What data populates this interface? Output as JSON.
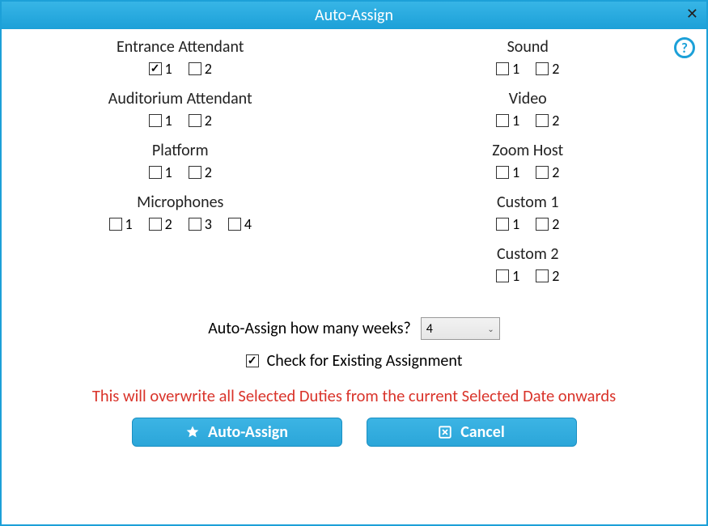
{
  "title": "Auto-Assign",
  "help_icon": "?",
  "groups_left": [
    {
      "label": "Entrance Attendant",
      "boxes": [
        {
          "label": "1",
          "checked": true
        },
        {
          "label": "2",
          "checked": false
        }
      ]
    },
    {
      "label": "Auditorium Attendant",
      "boxes": [
        {
          "label": "1",
          "checked": false
        },
        {
          "label": "2",
          "checked": false
        }
      ]
    },
    {
      "label": "Platform",
      "boxes": [
        {
          "label": "1",
          "checked": false
        },
        {
          "label": "2",
          "checked": false
        }
      ]
    },
    {
      "label": "Microphones",
      "boxes": [
        {
          "label": "1",
          "checked": false
        },
        {
          "label": "2",
          "checked": false
        },
        {
          "label": "3",
          "checked": false
        },
        {
          "label": "4",
          "checked": false
        }
      ]
    }
  ],
  "groups_right": [
    {
      "label": "Sound",
      "boxes": [
        {
          "label": "1",
          "checked": false
        },
        {
          "label": "2",
          "checked": false
        }
      ]
    },
    {
      "label": "Video",
      "boxes": [
        {
          "label": "1",
          "checked": false
        },
        {
          "label": "2",
          "checked": false
        }
      ]
    },
    {
      "label": "Zoom Host",
      "boxes": [
        {
          "label": "1",
          "checked": false
        },
        {
          "label": "2",
          "checked": false
        }
      ]
    },
    {
      "label": "Custom 1",
      "boxes": [
        {
          "label": "1",
          "checked": false
        },
        {
          "label": "2",
          "checked": false
        }
      ]
    },
    {
      "label": "Custom 2",
      "boxes": [
        {
          "label": "1",
          "checked": false
        },
        {
          "label": "2",
          "checked": false
        }
      ]
    }
  ],
  "weeks_label": "Auto-Assign how many weeks?",
  "weeks_value": "4",
  "check_existing": {
    "label": "Check for Existing Assignment",
    "checked": true
  },
  "warning": "This will overwrite all Selected Duties from the current Selected Date onwards",
  "buttons": {
    "assign": "Auto-Assign",
    "cancel": "Cancel"
  }
}
